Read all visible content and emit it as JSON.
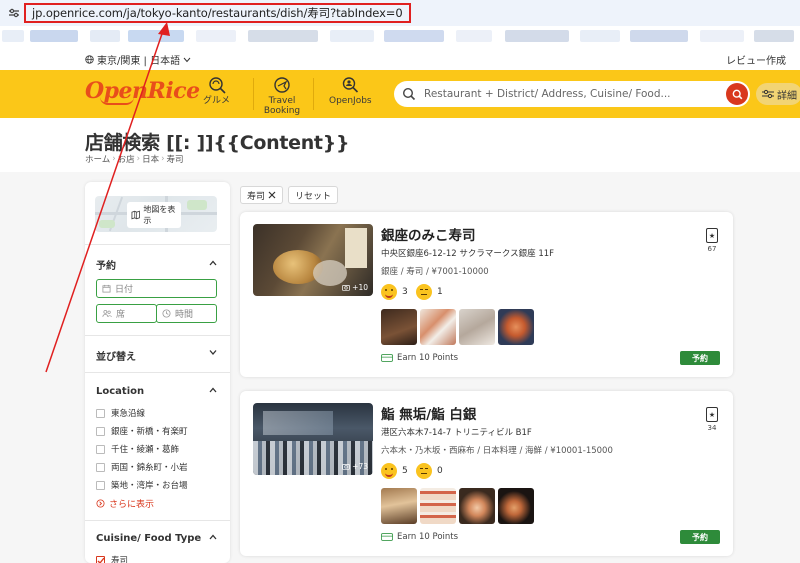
{
  "browser": {
    "url": "jp.openrice.com/ja/tokyo-kanto/restaurants/dish/寿司?tabIndex=0"
  },
  "top": {
    "region": "東京/関東 | 日本語",
    "review_link": "レビュー作成"
  },
  "header": {
    "logo": "OpenRice",
    "nav": [
      {
        "label": "グルメ",
        "icon": "gourmet-icon"
      },
      {
        "label": "Travel Booking",
        "icon": "travel-booking-icon"
      },
      {
        "label": "OpenJobs",
        "icon": "openjobs-icon"
      }
    ],
    "search_placeholder": "Restaurant + District/ Address, Cuisine/ Food...",
    "detail_label": "詳細"
  },
  "page": {
    "title": "店舗検索 [[: ]]{{Content}}",
    "breadcrumb": [
      "ホーム",
      "お店",
      "日本",
      "寿司"
    ]
  },
  "sidebar": {
    "map_label": "地図を表示",
    "reserve_heading": "予約",
    "date_placeholder": "日付",
    "seats_placeholder": "席",
    "time_placeholder": "時間",
    "sort_heading": "並び替え",
    "location_heading": "Location",
    "locations": [
      "東急沿線",
      "銀座・新橋・有楽町",
      "千住・綾瀬・葛飾",
      "両国・錦糸町・小岩",
      "築地・湾岸・お台場"
    ],
    "more_label": "さらに表示",
    "cuisine_heading": "Cuisine/ Food Type",
    "cuisine_items": [
      "寿司"
    ]
  },
  "filters": {
    "active_chip": "寿司",
    "reset_label": "リセット"
  },
  "restaurants": [
    {
      "name": "銀座のみこ寿司",
      "address": "中央区銀座6-12-12 サクラマークス銀座 11F",
      "category": "銀座 / 寿司 / ¥7001-10000",
      "smile_count": "3",
      "ok_count": "1",
      "photo_count": "+10",
      "bookmark_count": "67",
      "earn_label": "Earn 10 Points",
      "reserve_label": "予約"
    },
    {
      "name": "鮨 無垢/鮨 白銀",
      "address": "港区六本木7-14-7 トリニティビル B1F",
      "category": "六本木・乃木坂・西麻布 / 日本料理 / 海鮮 / ¥10001-15000",
      "smile_count": "5",
      "ok_count": "0",
      "photo_count": "+73",
      "bookmark_count": "34",
      "earn_label": "Earn 10 Points",
      "reserve_label": "予約"
    }
  ],
  "colors": {
    "brand_yellow": "#fbc718",
    "brand_orange": "#e84e1b",
    "reserve_green": "#2e8b3a",
    "annotation_red": "#e02020"
  }
}
